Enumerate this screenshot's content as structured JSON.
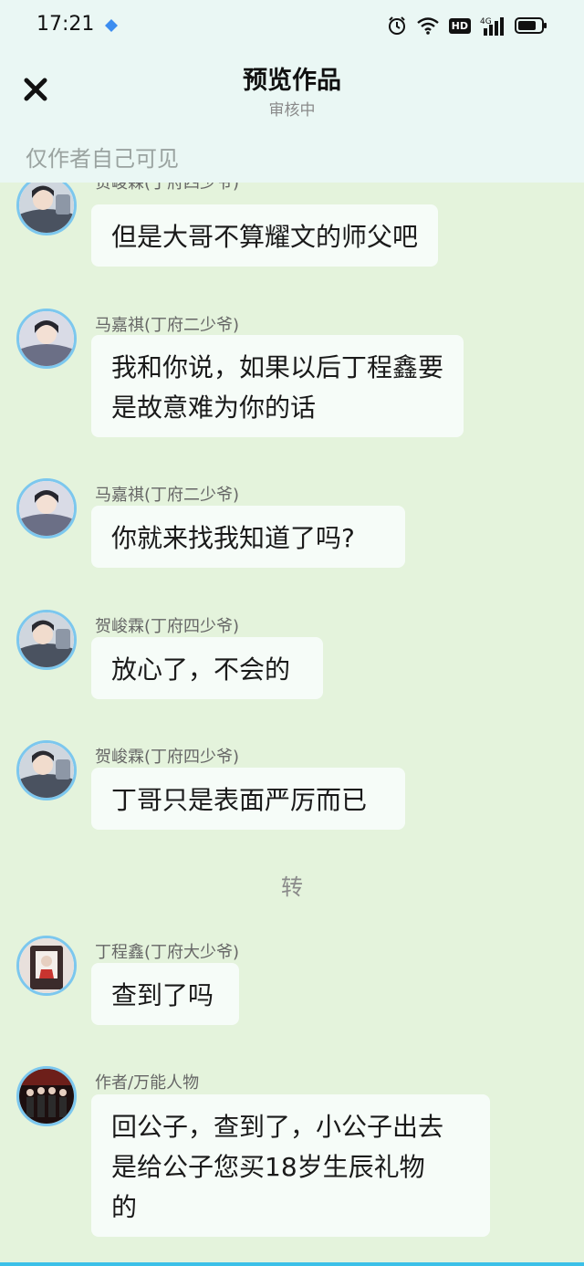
{
  "status_bar": {
    "time": "17:21",
    "network": "4G"
  },
  "header": {
    "title": "预览作品",
    "subtitle": "审核中",
    "visibility_note": "仅作者自己可见"
  },
  "messages": [
    {
      "sender": "贺峻霖(丁府四少爷)",
      "line1": "但是大哥不算耀文的师父吧",
      "line2": "",
      "line3": "",
      "avatar": "portrait-avatar-he"
    },
    {
      "sender": "马嘉祺(丁府二少爷)",
      "line1": "我和你说，如果以后丁程鑫要",
      "line2": "是故意难为你的话",
      "line3": "",
      "avatar": "portrait-avatar-ma"
    },
    {
      "sender": "马嘉祺(丁府二少爷)",
      "line1": "你就来找我知道了吗?",
      "line2": "",
      "line3": "",
      "avatar": "portrait-avatar-ma"
    },
    {
      "sender": "贺峻霖(丁府四少爷)",
      "line1": "放心了，不会的",
      "line2": "",
      "line3": "",
      "avatar": "portrait-avatar-he"
    },
    {
      "sender": "贺峻霖(丁府四少爷)",
      "line1": "丁哥只是表面严厉而已",
      "line2": "",
      "line3": "",
      "avatar": "portrait-avatar-he"
    },
    {
      "sender": "丁程鑫(丁府大少爷)",
      "line1": "查到了吗",
      "line2": "",
      "line3": "",
      "avatar": "portrait-avatar-ding"
    },
    {
      "sender": "作者/万能人物",
      "line1": "回公子，查到了，小公子出去",
      "line2": "是给公子您买18岁生辰礼物",
      "line3": "的",
      "avatar": "group-avatar-author"
    }
  ],
  "scene_divider": "转",
  "colors": {
    "chat_background": "#e4f3dc",
    "header_background": "#eaf7f4",
    "bubble": "#f6fcf8",
    "avatar_ring": "#7cc7ee"
  }
}
